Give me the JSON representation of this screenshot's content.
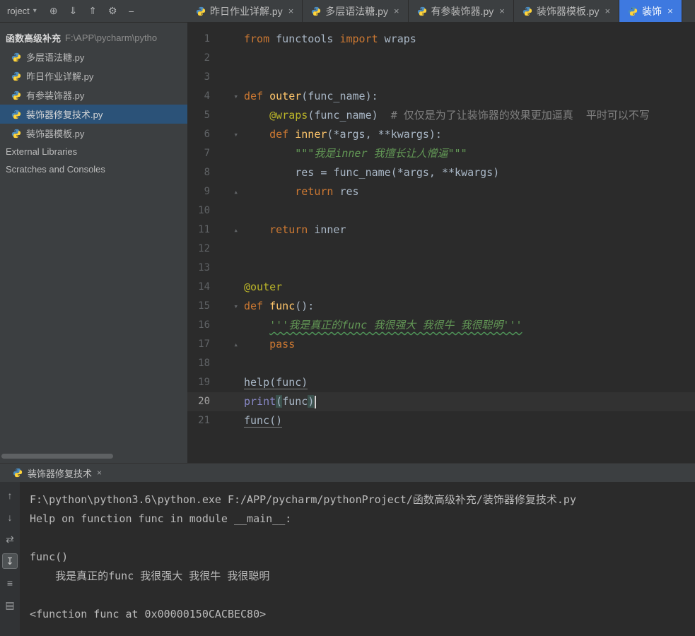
{
  "colors": {
    "accent_blue": "#3e79e0",
    "selection_blue": "#2b5278",
    "editor_bg": "#2b2b2b",
    "panel_bg": "#3c3f41"
  },
  "topbar": {
    "project_label": "roject",
    "icons": [
      {
        "name": "locate-icon",
        "glyph": "⊕"
      },
      {
        "name": "collapse-all-icon",
        "glyph": "⇓"
      },
      {
        "name": "expand-all-icon",
        "glyph": "⇑"
      },
      {
        "name": "settings-gear-icon",
        "glyph": "⚙"
      },
      {
        "name": "hide-panel-icon",
        "glyph": "−"
      }
    ]
  },
  "tabs": [
    {
      "label": "昨日作业详解.py",
      "active": false
    },
    {
      "label": "多层语法糖.py",
      "active": false
    },
    {
      "label": "有参装饰器.py",
      "active": false
    },
    {
      "label": "装饰器模板.py",
      "active": false
    },
    {
      "label": "装饰",
      "active": true
    }
  ],
  "sidebar": {
    "root_name": "函数高级补充",
    "root_path": "F:\\APP\\pycharm\\pytho",
    "files": [
      {
        "label": "多层语法糖.py",
        "selected": false
      },
      {
        "label": "昨日作业详解.py",
        "selected": false
      },
      {
        "label": "有参装饰器.py",
        "selected": false
      },
      {
        "label": "装饰器修复技术.py",
        "selected": true
      },
      {
        "label": "装饰器模板.py",
        "selected": false
      }
    ],
    "nodes": [
      {
        "label": "External Libraries"
      },
      {
        "label": "Scratches and Consoles"
      }
    ]
  },
  "editor": {
    "lines": [
      {
        "n": 1,
        "tokens": [
          [
            "kw",
            "from"
          ],
          [
            "pl",
            " functools "
          ],
          [
            "kw",
            "import"
          ],
          [
            "pl",
            " wraps"
          ]
        ]
      },
      {
        "n": 2,
        "tokens": []
      },
      {
        "n": 3,
        "tokens": []
      },
      {
        "n": 4,
        "fold": "down",
        "tokens": [
          [
            "kw",
            "def"
          ],
          [
            "pl",
            " "
          ],
          [
            "fn",
            "outer"
          ],
          [
            "pl",
            "(func_name):"
          ]
        ]
      },
      {
        "n": 5,
        "tokens": [
          [
            "pl",
            "    "
          ],
          [
            "deco",
            "@wraps"
          ],
          [
            "pl",
            "(func_name)  "
          ],
          [
            "cm",
            "# 仅仅是为了让装饰器的效果更加逼真  平时可以不写"
          ]
        ]
      },
      {
        "n": 6,
        "fold": "down",
        "tokens": [
          [
            "pl",
            "    "
          ],
          [
            "kw",
            "def"
          ],
          [
            "pl",
            " "
          ],
          [
            "fn",
            "inner"
          ],
          [
            "pl",
            "(*args, **kwargs):"
          ]
        ]
      },
      {
        "n": 7,
        "tokens": [
          [
            "pl",
            "        "
          ],
          [
            "doc",
            "\"\"\"我是inner 我擅长让人憎逼\"\"\""
          ]
        ]
      },
      {
        "n": 8,
        "tokens": [
          [
            "pl",
            "        res = func_name(*args, **kwargs)"
          ]
        ]
      },
      {
        "n": 9,
        "fold": "up",
        "tokens": [
          [
            "pl",
            "        "
          ],
          [
            "kw",
            "return"
          ],
          [
            "pl",
            " res"
          ]
        ]
      },
      {
        "n": 10,
        "tokens": []
      },
      {
        "n": 11,
        "fold": "up",
        "tokens": [
          [
            "pl",
            "    "
          ],
          [
            "kw",
            "return"
          ],
          [
            "pl",
            " inner"
          ]
        ]
      },
      {
        "n": 12,
        "tokens": []
      },
      {
        "n": 13,
        "tokens": []
      },
      {
        "n": 14,
        "tokens": [
          [
            "deco",
            "@outer"
          ]
        ]
      },
      {
        "n": 15,
        "fold": "down",
        "tokens": [
          [
            "kw",
            "def"
          ],
          [
            "pl",
            " "
          ],
          [
            "fn",
            "func"
          ],
          [
            "pl",
            "():"
          ]
        ]
      },
      {
        "n": 16,
        "tokens": [
          [
            "pl",
            "    "
          ],
          [
            "docw",
            "'''我是真正的func 我很强大 我很牛 我很聪明'''"
          ]
        ]
      },
      {
        "n": 17,
        "fold": "up",
        "tokens": [
          [
            "pl",
            "    "
          ],
          [
            "kw",
            "pass"
          ]
        ]
      },
      {
        "n": 18,
        "tokens": []
      },
      {
        "n": 19,
        "tokens": [
          [
            "ul",
            "help(func)"
          ]
        ]
      },
      {
        "n": 20,
        "current": true,
        "tokens": [
          [
            "bi",
            "print"
          ],
          [
            "br",
            "("
          ],
          [
            "pl",
            "func"
          ],
          [
            "br",
            ")"
          ],
          [
            "cursor",
            ""
          ]
        ]
      },
      {
        "n": 21,
        "tokens": [
          [
            "ul",
            "func()"
          ]
        ]
      }
    ]
  },
  "console": {
    "tab_label": "装饰器修复技术",
    "toolbar": [
      {
        "name": "up-arrow-icon",
        "glyph": "↑",
        "selected": false
      },
      {
        "name": "down-arrow-icon",
        "glyph": "↓",
        "selected": false
      },
      {
        "name": "rerun-icon",
        "glyph": "⇄",
        "selected": false
      },
      {
        "name": "scroll-to-end-icon",
        "glyph": "↧",
        "selected": true
      },
      {
        "name": "print-output-icon",
        "glyph": "≡",
        "selected": false
      },
      {
        "name": "clear-output-icon",
        "glyph": "▤",
        "selected": false
      }
    ],
    "lines": [
      "F:\\python\\python3.6\\python.exe F:/APP/pycharm/pythonProject/函数高级补充/装饰器修复技术.py",
      "Help on function func in module __main__:",
      "",
      "func()",
      "    我是真正的func 我很强大 我很牛 我很聪明",
      "",
      "<function func at 0x00000150CACBEC80>"
    ]
  }
}
